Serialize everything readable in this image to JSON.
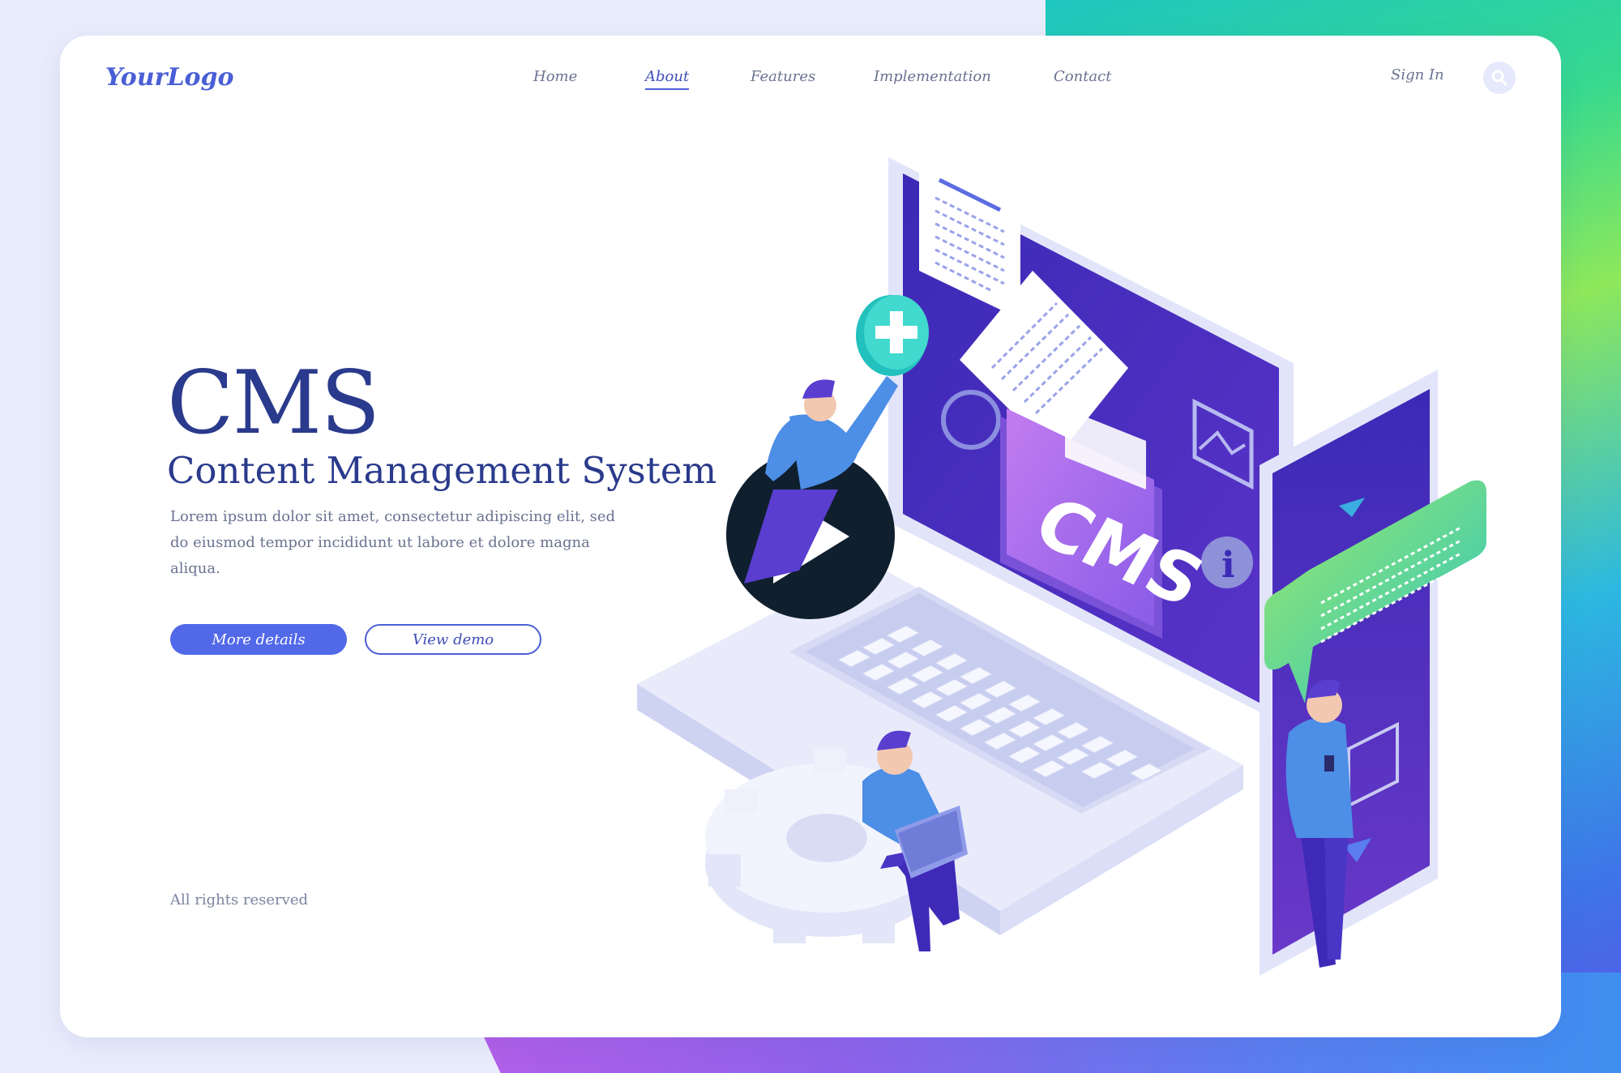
{
  "logo": "YourLogo",
  "nav": {
    "items": [
      {
        "label": "Home",
        "active": false
      },
      {
        "label": "About",
        "active": true
      },
      {
        "label": "Features",
        "active": false
      },
      {
        "label": "Implementation",
        "active": false
      },
      {
        "label": "Contact",
        "active": false
      }
    ],
    "sign_in": "Sign In"
  },
  "hero": {
    "title": "CMS",
    "subtitle": "Content Management System",
    "description": "Lorem ipsum dolor sit amet, consectetur adipiscing elit, sed do eiusmod tempor incididunt ut labore et dolore magna aliqua.",
    "primary_button": "More details",
    "secondary_button": "View demo"
  },
  "illustration": {
    "folder_label": "CMS"
  },
  "footer": "All rights reserved",
  "colors": {
    "accent": "#5168e8",
    "heading": "#2a3a8c",
    "screen": "#3a2cb0"
  }
}
